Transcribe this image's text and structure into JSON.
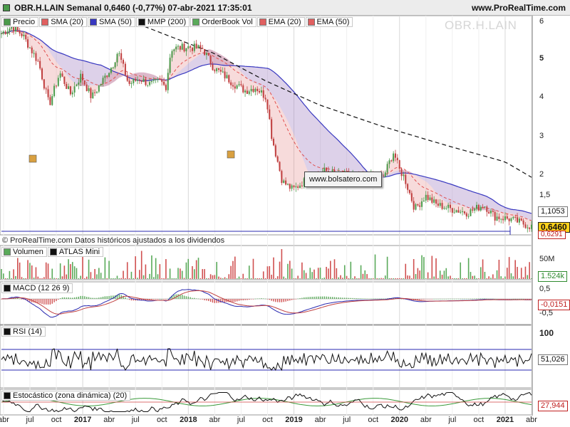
{
  "header": {
    "title": "OBR.H.LAIN Semanal 0,6460 (-0,77%) 07-abr-2021 17:35:01",
    "site": "www.ProRealTime.com"
  },
  "watermark": "OBR.H.LAIN",
  "note": "www.bolsatero.com",
  "credit": "© ProRealTime.com Datos históricos ajustados a los dividendos",
  "colors": {
    "up_candle": "#4a9a4a",
    "down_candle": "#c04040",
    "sma20": "#e05050",
    "sma50": "#3838c0",
    "mmp200": "#111111",
    "volume_up": "#5aaa5a",
    "volume_down": "#d05050"
  },
  "legend": {
    "main": [
      {
        "label": "Precio",
        "color": "#4a9a4a"
      },
      {
        "label": "SMA (20)",
        "color": "#e06060"
      },
      {
        "label": "SMA (50)",
        "color": "#3838c0"
      },
      {
        "label": "MMP (200)",
        "color": "#111111"
      },
      {
        "label": "OrderBook Vol",
        "color": "#5aaa5a"
      },
      {
        "label": "EMA (20)",
        "color": "#e06060"
      },
      {
        "label": "EMA (50)",
        "color": "#e06060"
      }
    ],
    "volume": [
      {
        "label": "Volumen",
        "color": "#5aaa5a"
      },
      {
        "label": "ATLAS Mini",
        "color": "#111111"
      }
    ],
    "macd": [
      {
        "label": "MACD (12 26 9)",
        "color": "#111111"
      }
    ],
    "rsi": [
      {
        "label": "RSI (14)",
        "color": "#111111"
      }
    ],
    "stoch": [
      {
        "label": "Estocástico (zona dinámica) (20)",
        "color": "#111111"
      }
    ]
  },
  "price_axis": {
    "ticks": [
      "6",
      "5",
      "4",
      "3",
      "2",
      "1,5"
    ],
    "tags": {
      "top": "1,1053",
      "current": "0,6460",
      "low": "0,6291"
    }
  },
  "volume_axis": {
    "ticks": [
      "50M"
    ],
    "value": "1.524k"
  },
  "macd_axis": {
    "ticks": [
      "0,5",
      "-0,5"
    ],
    "values": [
      "-0,0151"
    ]
  },
  "rsi_axis": {
    "ticks": [
      "100"
    ],
    "value": "51,026"
  },
  "stoch_axis": {
    "value": "27,944"
  },
  "x_axis": {
    "labels": [
      {
        "text": "abr",
        "year": false
      },
      {
        "text": "jul",
        "year": false
      },
      {
        "text": "oct",
        "year": false
      },
      {
        "text": "2017",
        "year": true
      },
      {
        "text": "abr",
        "year": false
      },
      {
        "text": "jul",
        "year": false
      },
      {
        "text": "oct",
        "year": false
      },
      {
        "text": "2018",
        "year": true
      },
      {
        "text": "abr",
        "year": false
      },
      {
        "text": "jul",
        "year": false
      },
      {
        "text": "oct",
        "year": false
      },
      {
        "text": "2019",
        "year": true
      },
      {
        "text": "abr",
        "year": false
      },
      {
        "text": "jul",
        "year": false
      },
      {
        "text": "oct",
        "year": false
      },
      {
        "text": "2020",
        "year": true
      },
      {
        "text": "abr",
        "year": false
      },
      {
        "text": "jul",
        "year": false
      },
      {
        "text": "oct",
        "year": false
      },
      {
        "text": "2021",
        "year": true
      },
      {
        "text": "abr",
        "year": false
      }
    ]
  },
  "chart_data": {
    "type": "line",
    "x_start": "2016-04",
    "x_end": "2021-04",
    "y_scale": "log",
    "ylim": [
      0.6,
      6.2
    ],
    "price_anchors": [
      {
        "t": 0.0,
        "v": 5.2
      },
      {
        "t": 0.02,
        "v": 5.6
      },
      {
        "t": 0.04,
        "v": 5.1
      },
      {
        "t": 0.07,
        "v": 3.8
      },
      {
        "t": 0.09,
        "v": 2.4
      },
      {
        "t": 0.11,
        "v": 3.4
      },
      {
        "t": 0.13,
        "v": 2.7
      },
      {
        "t": 0.15,
        "v": 3.3
      },
      {
        "t": 0.17,
        "v": 2.6
      },
      {
        "t": 0.19,
        "v": 3.1
      },
      {
        "t": 0.21,
        "v": 3.7
      },
      {
        "t": 0.22,
        "v": 4.3
      },
      {
        "t": 0.24,
        "v": 3.0
      },
      {
        "t": 0.26,
        "v": 3.2
      },
      {
        "t": 0.28,
        "v": 3.0
      },
      {
        "t": 0.3,
        "v": 3.1
      },
      {
        "t": 0.31,
        "v": 2.9
      },
      {
        "t": 0.32,
        "v": 4.4
      },
      {
        "t": 0.35,
        "v": 4.5
      },
      {
        "t": 0.38,
        "v": 4.4
      },
      {
        "t": 0.4,
        "v": 3.6
      },
      {
        "t": 0.42,
        "v": 3.3
      },
      {
        "t": 0.44,
        "v": 3.0
      },
      {
        "t": 0.46,
        "v": 2.8
      },
      {
        "t": 0.48,
        "v": 2.9
      },
      {
        "t": 0.5,
        "v": 2.6
      },
      {
        "t": 0.51,
        "v": 1.7
      },
      {
        "t": 0.53,
        "v": 1.05
      },
      {
        "t": 0.55,
        "v": 0.96
      },
      {
        "t": 0.57,
        "v": 1.05
      },
      {
        "t": 0.59,
        "v": 1.1
      },
      {
        "t": 0.61,
        "v": 1.18
      },
      {
        "t": 0.64,
        "v": 1.12
      },
      {
        "t": 0.66,
        "v": 1.14
      },
      {
        "t": 0.68,
        "v": 1.08
      },
      {
        "t": 0.7,
        "v": 1.12
      },
      {
        "t": 0.72,
        "v": 1.1
      },
      {
        "t": 0.74,
        "v": 1.45
      },
      {
        "t": 0.75,
        "v": 1.2
      },
      {
        "t": 0.76,
        "v": 1.1
      },
      {
        "t": 0.78,
        "v": 0.78
      },
      {
        "t": 0.8,
        "v": 0.9
      },
      {
        "t": 0.82,
        "v": 0.82
      },
      {
        "t": 0.85,
        "v": 0.78
      },
      {
        "t": 0.88,
        "v": 0.75
      },
      {
        "t": 0.91,
        "v": 0.82
      },
      {
        "t": 0.93,
        "v": 0.72
      },
      {
        "t": 0.96,
        "v": 0.7
      },
      {
        "t": 1.0,
        "v": 0.646
      }
    ],
    "mmp200_anchors": [
      {
        "t": 0.27,
        "v": 5.6
      },
      {
        "t": 0.4,
        "v": 4.2
      },
      {
        "t": 0.5,
        "v": 3.1
      },
      {
        "t": 0.6,
        "v": 2.4
      },
      {
        "t": 0.72,
        "v": 1.9
      },
      {
        "t": 0.84,
        "v": 1.55
      },
      {
        "t": 0.95,
        "v": 1.3
      },
      {
        "t": 1.0,
        "v": 1.1
      }
    ]
  }
}
